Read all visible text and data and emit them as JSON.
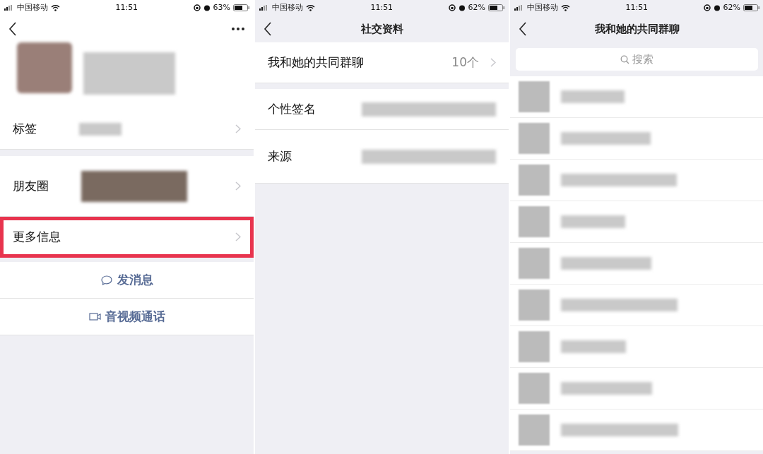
{
  "screens": [
    {
      "kind": "profile",
      "status_bar": {
        "carrier": "中国移动",
        "time": "11:51",
        "battery": "63%"
      },
      "rows": [
        {
          "label": "标签",
          "highlighted": false,
          "kind": "tags"
        },
        {
          "label": "朋友圈",
          "highlighted": false,
          "kind": "moments"
        },
        {
          "label": "更多信息",
          "highlighted": true,
          "kind": "plain"
        }
      ],
      "actions": [
        {
          "label": "发消息",
          "kind": "message"
        },
        {
          "label": "音视频通话",
          "kind": "video"
        }
      ]
    },
    {
      "kind": "social",
      "status_bar": {
        "carrier": "中国移动",
        "time": "11:51",
        "battery": "62%"
      },
      "title": "社交资料",
      "rows": [
        {
          "label": "我和她的共同群聊",
          "value": "10个"
        },
        {
          "label": "个性签名"
        },
        {
          "label": "来源"
        }
      ]
    },
    {
      "kind": "groups",
      "status_bar": {
        "carrier": "中国移动",
        "time": "11:51",
        "battery": "62%"
      },
      "title": "我和她的共同群聊",
      "search": {
        "placeholder": "搜索"
      }
    }
  ]
}
